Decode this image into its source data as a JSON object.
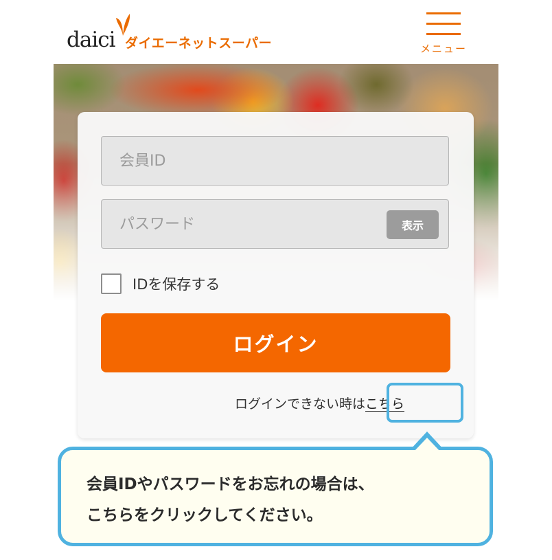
{
  "header": {
    "logo_word": "daici",
    "logo_tagline": "ダイエーネットスーパー",
    "menu_label": "メニュー"
  },
  "login": {
    "member_id_placeholder": "会員ID",
    "password_placeholder": "パスワード",
    "show_password_label": "表示",
    "remember_id_label": "IDを保存する",
    "remember_id_checked": false,
    "login_button_label": "ログイン",
    "forgot_text": "ログインできない時は",
    "forgot_link": "こちら"
  },
  "callout": {
    "line1": "会員IDやパスワードをお忘れの場合は、",
    "line2": "こちらをクリックしてください。"
  },
  "colors": {
    "brand": "#ea6b00",
    "login_button": "#f46700",
    "highlight": "#4fb2e0",
    "bubble_bg": "#fffef0"
  }
}
